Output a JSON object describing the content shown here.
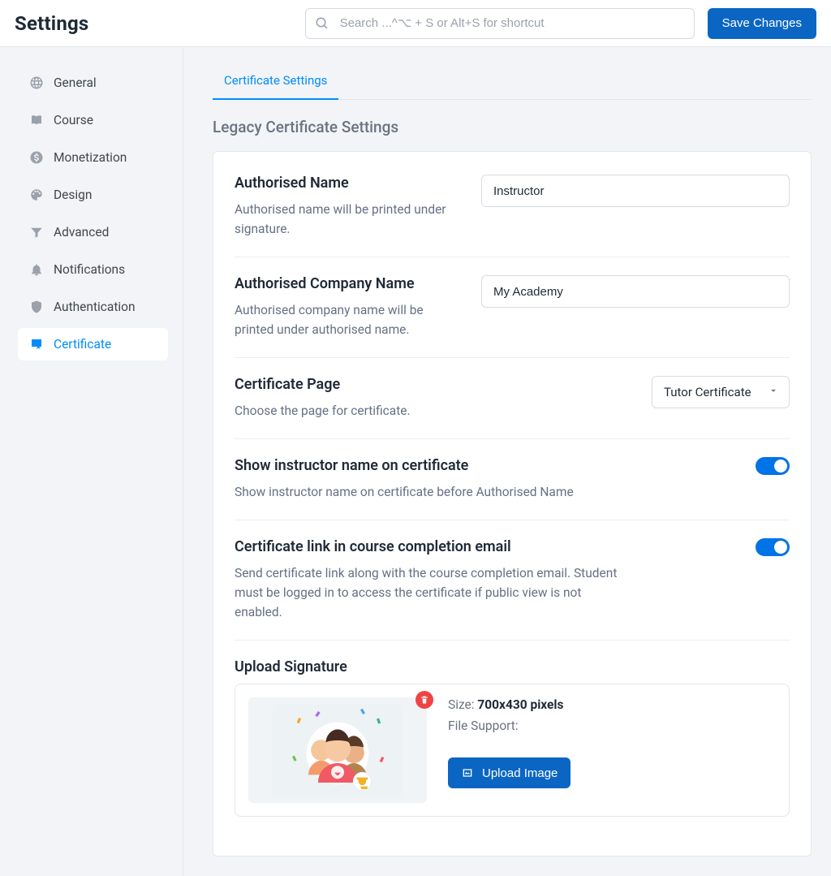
{
  "header": {
    "title": "Settings",
    "search_placeholder": "Search ...^⌥ + S or Alt+S for shortcut",
    "save_label": "Save Changes"
  },
  "sidebar": {
    "items": [
      {
        "label": "General"
      },
      {
        "label": "Course"
      },
      {
        "label": "Monetization"
      },
      {
        "label": "Design"
      },
      {
        "label": "Advanced"
      },
      {
        "label": "Notifications"
      },
      {
        "label": "Authentication"
      },
      {
        "label": "Certificate"
      }
    ]
  },
  "tab": {
    "label": "Certificate Settings"
  },
  "section": {
    "title": "Legacy Certificate Settings"
  },
  "rows": {
    "auth_name": {
      "title": "Authorised Name",
      "desc": "Authorised name will be printed under signature.",
      "value": "Instructor"
    },
    "auth_company": {
      "title": "Authorised Company Name",
      "desc": "Authorised company name will be printed under authorised name.",
      "value": "My Academy"
    },
    "cert_page": {
      "title": "Certificate Page",
      "desc": "Choose the page for certificate.",
      "value": "Tutor Certificate"
    },
    "instr_name": {
      "title": "Show instructor name on certificate",
      "desc": "Show instructor name on certificate before Authorised Name"
    },
    "cert_link": {
      "title": "Certificate link in course completion email",
      "desc": "Send certificate link along with the course completion email. Student must be logged in to access the certificate if public view is not enabled."
    },
    "upload": {
      "title": "Upload Signature",
      "size_label": "Size:",
      "size_value": "700x430 pixels",
      "support_label": "File Support:",
      "button": "Upload Image"
    }
  }
}
